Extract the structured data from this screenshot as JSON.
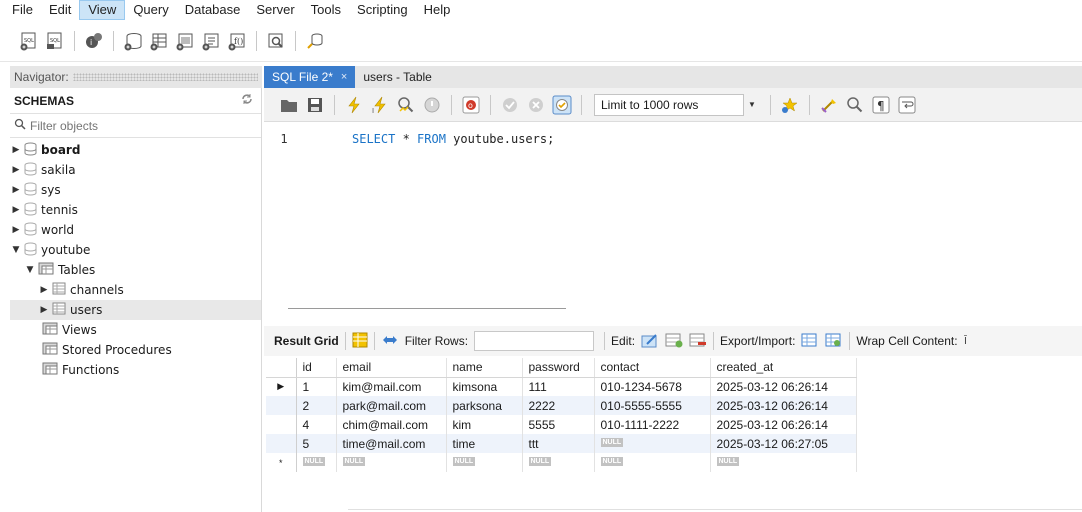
{
  "menu": [
    "File",
    "Edit",
    "View",
    "Query",
    "Database",
    "Server",
    "Tools",
    "Scripting",
    "Help"
  ],
  "menu_active_index": 2,
  "navigator": {
    "header": "Navigator:",
    "schemas_title": "SCHEMAS",
    "filter_placeholder": "Filter objects",
    "schemas": [
      {
        "name": "board",
        "bold": true
      },
      {
        "name": "sakila"
      },
      {
        "name": "sys"
      },
      {
        "name": "tennis"
      },
      {
        "name": "world"
      },
      {
        "name": "youtube"
      }
    ],
    "youtube_children": {
      "tables_label": "Tables",
      "tables": [
        "channels",
        "users"
      ],
      "views_label": "Views",
      "procedures_label": "Stored Procedures",
      "functions_label": "Functions"
    }
  },
  "tabs": [
    {
      "label": "SQL File 2*",
      "active": true,
      "close": "×"
    },
    {
      "label": "users - Table",
      "active": false
    }
  ],
  "sql_toolbar": {
    "limit_label": "Limit to 1000 rows"
  },
  "editor": {
    "line_number": "1",
    "code": {
      "kw1": "SELECT",
      "star": " * ",
      "kw2": "FROM",
      "rest": " youtube.users;"
    }
  },
  "result_toolbar": {
    "result_grid": "Result Grid",
    "filter_rows": "Filter Rows:",
    "edit": "Edit:",
    "export_import": "Export/Import:",
    "wrap": "Wrap Cell Content:"
  },
  "grid": {
    "columns": [
      "id",
      "email",
      "name",
      "password",
      "contact",
      "created_at"
    ],
    "rows": [
      [
        "1",
        "kim@mail.com",
        "kimsona",
        "111",
        "010-1234-5678",
        "2025-03-12 06:26:14"
      ],
      [
        "2",
        "park@mail.com",
        "parksona",
        "2222",
        "010-5555-5555",
        "2025-03-12 06:26:14"
      ],
      [
        "4",
        "chim@mail.com",
        "kim",
        "5555",
        "010-1111-2222",
        "2025-03-12 06:26:14"
      ],
      [
        "5",
        "time@mail.com",
        "time",
        "ttt",
        "NULL",
        "2025-03-12 06:27:05"
      ]
    ],
    "null_label": "NULL",
    "current_marker": "▶",
    "new_marker": "*"
  },
  "colors": {
    "active_tab": "#3a7ccc",
    "sql_keyword": "#1a73c7",
    "alt_row": "#eef3fb"
  }
}
